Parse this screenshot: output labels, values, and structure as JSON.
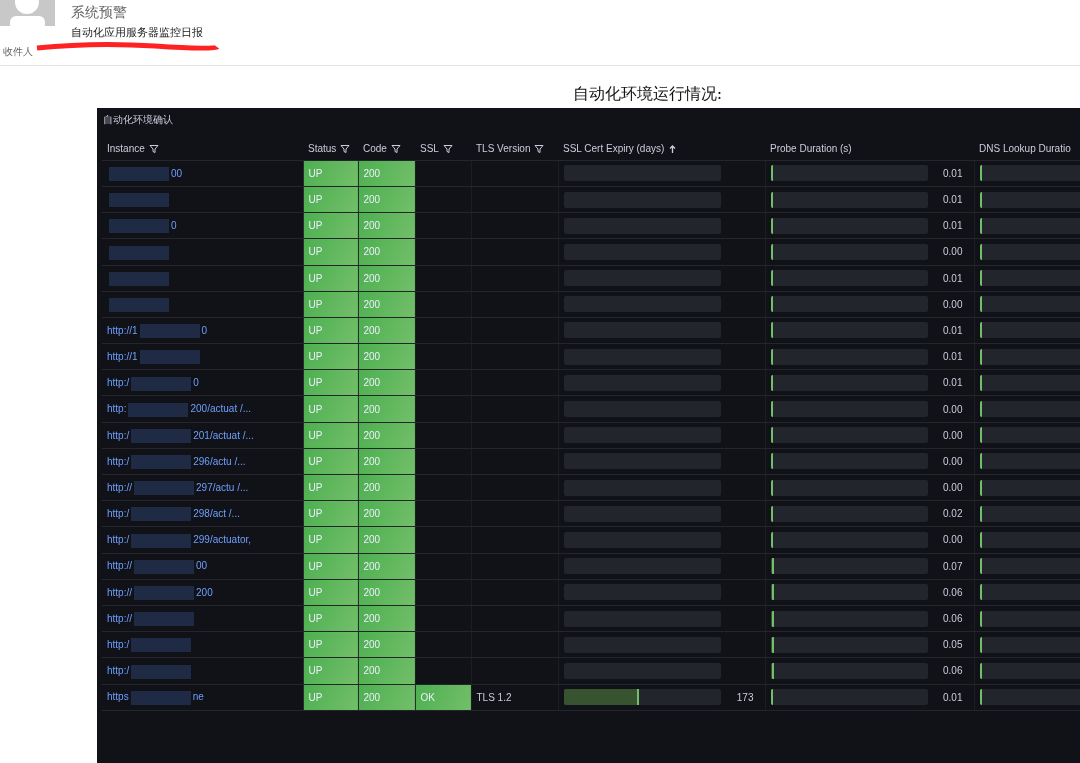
{
  "email": {
    "sender": "系统预警",
    "subject": "自动化应用服务器监控日报",
    "recipient_label": "收件人"
  },
  "heading": "自动化环境运行情况:",
  "panel": {
    "title": "自动化环境确认",
    "columns": [
      {
        "label": "Instance",
        "filter": true,
        "sorted": false
      },
      {
        "label": "Status",
        "filter": true,
        "sorted": false
      },
      {
        "label": "Code",
        "filter": true,
        "sorted": false
      },
      {
        "label": "SSL",
        "filter": true,
        "sorted": false
      },
      {
        "label": "TLS Version",
        "filter": true,
        "sorted": false
      },
      {
        "label": "SSL Cert Expiry (days)",
        "filter": false,
        "sorted": true
      },
      {
        "label": "Probe Duration (s)",
        "filter": false,
        "sorted": false
      },
      {
        "label": "DNS Lookup Duratio",
        "filter": false,
        "sorted": false
      }
    ],
    "rows": [
      {
        "instance_start": "",
        "instance_end": "00",
        "status": "UP",
        "code": "200",
        "probe": {
          "level": 0.01,
          "value": "0.01"
        },
        "dns": {
          "level": 0.01
        }
      },
      {
        "instance_start": "",
        "instance_end": "",
        "status": "UP",
        "code": "200",
        "probe": {
          "level": 0.01,
          "value": "0.01"
        },
        "dns": {
          "level": 0.01
        }
      },
      {
        "instance_start": "",
        "instance_end": "0",
        "status": "UP",
        "code": "200",
        "probe": {
          "level": 0.01,
          "value": "0.01"
        },
        "dns": {
          "level": 0.01
        }
      },
      {
        "instance_start": "",
        "instance_end": "",
        "status": "UP",
        "code": "200",
        "probe": {
          "level": 0.01,
          "value": "0.00"
        },
        "dns": {
          "level": 0.01
        }
      },
      {
        "instance_start": "",
        "instance_end": "",
        "status": "UP",
        "code": "200",
        "probe": {
          "level": 0.01,
          "value": "0.01"
        },
        "dns": {
          "level": 0.01
        }
      },
      {
        "instance_start": "",
        "instance_end": "",
        "status": "UP",
        "code": "200",
        "probe": {
          "level": 0.01,
          "value": "0.00"
        },
        "dns": {
          "level": 0.01
        }
      },
      {
        "instance_start": "http://1",
        "instance_end": "0",
        "status": "UP",
        "code": "200",
        "probe": {
          "level": 0.01,
          "value": "0.01"
        },
        "dns": {
          "level": 0.01
        }
      },
      {
        "instance_start": "http://1",
        "instance_end": "",
        "status": "UP",
        "code": "200",
        "probe": {
          "level": 0.01,
          "value": "0.01"
        },
        "dns": {
          "level": 0.01
        }
      },
      {
        "instance_start": "http:/",
        "instance_end": "0",
        "status": "UP",
        "code": "200",
        "probe": {
          "level": 0.01,
          "value": "0.01"
        },
        "dns": {
          "level": 0.01
        }
      },
      {
        "instance_start": "http:",
        "instance_end": "200/actuat /...",
        "status": "UP",
        "code": "200",
        "probe": {
          "level": 0.01,
          "value": "0.00"
        },
        "dns": {
          "level": 0.01
        }
      },
      {
        "instance_start": "http:/",
        "instance_end": "201/actuat /...",
        "status": "UP",
        "code": "200",
        "probe": {
          "level": 0.01,
          "value": "0.00"
        },
        "dns": {
          "level": 0.01
        }
      },
      {
        "instance_start": "http:/",
        "instance_end": "296/actu /...",
        "status": "UP",
        "code": "200",
        "probe": {
          "level": 0.01,
          "value": "0.00"
        },
        "dns": {
          "level": 0.01
        }
      },
      {
        "instance_start": "http://",
        "instance_end": "297/actu /...",
        "status": "UP",
        "code": "200",
        "probe": {
          "level": 0.01,
          "value": "0.00"
        },
        "dns": {
          "level": 0.01
        }
      },
      {
        "instance_start": "http:/",
        "instance_end": "298/act /...",
        "status": "UP",
        "code": "200",
        "probe": {
          "level": 0.01,
          "value": "0.02"
        },
        "dns": {
          "level": 0.01
        }
      },
      {
        "instance_start": "http:/",
        "instance_end": "299/actuator,",
        "status": "UP",
        "code": "200",
        "probe": {
          "level": 0.01,
          "value": "0.00"
        },
        "dns": {
          "level": 0.01
        }
      },
      {
        "instance_start": "http://",
        "instance_end": "00",
        "status": "UP",
        "code": "200",
        "probe": {
          "level": 0.02,
          "value": "0.07"
        },
        "dns": {
          "level": 0.01
        }
      },
      {
        "instance_start": "http://",
        "instance_end": "200",
        "status": "UP",
        "code": "200",
        "probe": {
          "level": 0.02,
          "value": "0.06"
        },
        "dns": {
          "level": 0.01
        }
      },
      {
        "instance_start": "http://",
        "instance_end": "",
        "status": "UP",
        "code": "200",
        "probe": {
          "level": 0.02,
          "value": "0.06"
        },
        "dns": {
          "level": 0.01
        }
      },
      {
        "instance_start": "http:/",
        "instance_end": "",
        "status": "UP",
        "code": "200",
        "probe": {
          "level": 0.02,
          "value": "0.05"
        },
        "dns": {
          "level": 0.01
        }
      },
      {
        "instance_start": "http:/",
        "instance_end": "",
        "status": "UP",
        "code": "200",
        "probe": {
          "level": 0.02,
          "value": "0.06"
        },
        "dns": {
          "level": 0.01
        }
      },
      {
        "instance_start": "https",
        "instance_end": "ne",
        "status": "UP",
        "code": "200",
        "ssl": "OK",
        "tls": "TLS 1.2",
        "expiry": {
          "level": 0.48,
          "value": "173"
        },
        "probe": {
          "level": 0.01,
          "value": "0.01"
        },
        "dns": {
          "level": 0.01
        }
      }
    ]
  }
}
